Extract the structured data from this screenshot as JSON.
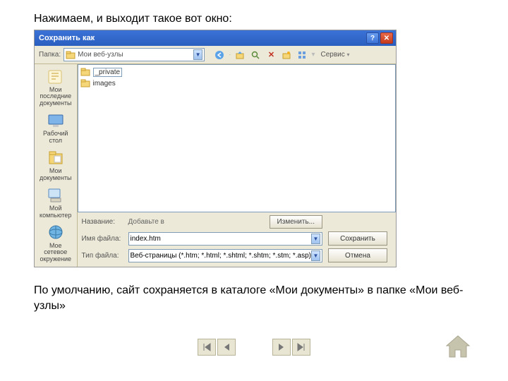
{
  "page": {
    "heading": "Нажимаем, и выходит такое вот окно:",
    "caption": "По умолчанию, сайт сохраняется в каталоге «Мои документы» в папке «Мои веб-узлы»"
  },
  "dialog": {
    "title": "Сохранить как",
    "toolbar": {
      "folder_label": "Папка:",
      "folder_value": "Мои веб-узлы",
      "tools_label": "Сервис"
    },
    "places": [
      {
        "label": "Мои последние документы"
      },
      {
        "label": "Рабочий стол"
      },
      {
        "label": "Мои документы"
      },
      {
        "label": "Мой компьютер"
      },
      {
        "label": "Мое сетевое окружение"
      }
    ],
    "files": [
      {
        "label": "_private"
      },
      {
        "label": "images"
      }
    ],
    "fields": {
      "page_title_label": "Название:",
      "page_title_value": "Добавьте в",
      "change_button": "Изменить...",
      "filename_label": "Имя файла:",
      "filename_value": "index.htm",
      "filetype_label": "Тип файла:",
      "filetype_value": "Веб-страницы (*.htm; *.html; *.shtml; *.shtm; *.stm; *.asp)"
    },
    "buttons": {
      "save": "Сохранить",
      "cancel": "Отмена"
    }
  }
}
